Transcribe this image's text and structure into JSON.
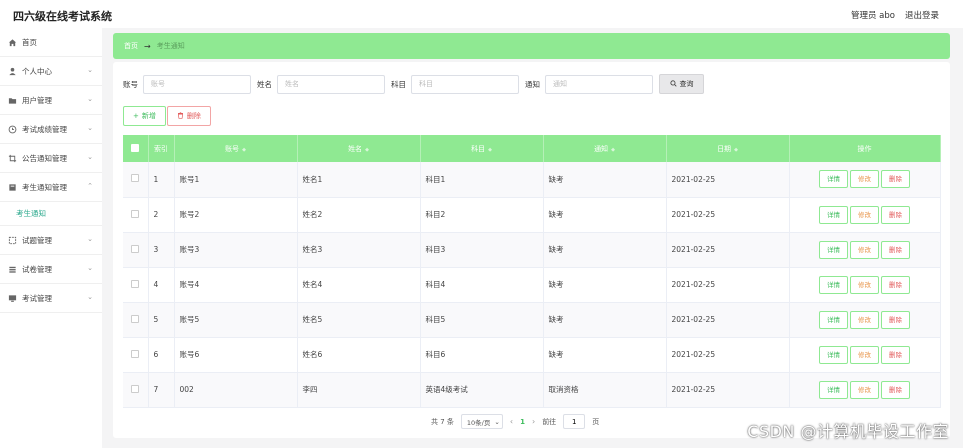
{
  "header": {
    "title": "四六级在线考试系统",
    "admin_label": "管理员 abo",
    "logout_label": "退出登录"
  },
  "sidebar": {
    "items": [
      {
        "label": "首页",
        "icon": "home-icon"
      },
      {
        "label": "个人中心",
        "icon": "user-icon"
      },
      {
        "label": "用户管理",
        "icon": "folder-icon"
      },
      {
        "label": "考试成绩管理",
        "icon": "clock-icon"
      },
      {
        "label": "公告通知管理",
        "icon": "crop-icon"
      },
      {
        "label": "考生通知管理",
        "icon": "doc-icon",
        "expanded": true,
        "sub": "考生通知"
      },
      {
        "label": "试题管理",
        "icon": "frame-icon"
      },
      {
        "label": "试卷管理",
        "icon": "list-icon"
      },
      {
        "label": "考试管理",
        "icon": "monitor-icon"
      }
    ]
  },
  "breadcrumb": {
    "home": "首页",
    "current": "考生通知"
  },
  "search": {
    "account_label": "账号",
    "account_placeholder": "账号",
    "name_label": "姓名",
    "name_placeholder": "姓名",
    "subject_label": "科目",
    "subject_placeholder": "科目",
    "notice_label": "通知",
    "notice_placeholder": "通知",
    "button_label": "查询"
  },
  "actions": {
    "add_label": "新增",
    "delete_label": "删除"
  },
  "table": {
    "columns": [
      "索引",
      "账号",
      "姓名",
      "科目",
      "通知",
      "日期",
      "操作"
    ],
    "rows": [
      {
        "index": "1",
        "account": "账号1",
        "name": "姓名1",
        "subject": "科目1",
        "notice": "缺考",
        "date": "2021-02-25"
      },
      {
        "index": "2",
        "account": "账号2",
        "name": "姓名2",
        "subject": "科目2",
        "notice": "缺考",
        "date": "2021-02-25"
      },
      {
        "index": "3",
        "account": "账号3",
        "name": "姓名3",
        "subject": "科目3",
        "notice": "缺考",
        "date": "2021-02-25"
      },
      {
        "index": "4",
        "account": "账号4",
        "name": "姓名4",
        "subject": "科目4",
        "notice": "缺考",
        "date": "2021-02-25"
      },
      {
        "index": "5",
        "account": "账号5",
        "name": "姓名5",
        "subject": "科目5",
        "notice": "缺考",
        "date": "2021-02-25"
      },
      {
        "index": "6",
        "account": "账号6",
        "name": "姓名6",
        "subject": "科目6",
        "notice": "缺考",
        "date": "2021-02-25"
      },
      {
        "index": "7",
        "account": "002",
        "name": "李四",
        "subject": "英语4级考试",
        "notice": "取消资格",
        "date": "2021-02-25"
      }
    ],
    "op_detail": "详情",
    "op_edit": "修改",
    "op_delete": "删除"
  },
  "pagination": {
    "total_text": "共 7 条",
    "page_size": "10条/页",
    "current_page": "1",
    "goto_label": "前往",
    "goto_value": "1",
    "page_suffix": "页"
  },
  "watermark": "CSDN @计算机毕设工作室",
  "colors": {
    "accent": "#8fe992",
    "danger": "#e25a5a",
    "warning": "#e8964d"
  }
}
